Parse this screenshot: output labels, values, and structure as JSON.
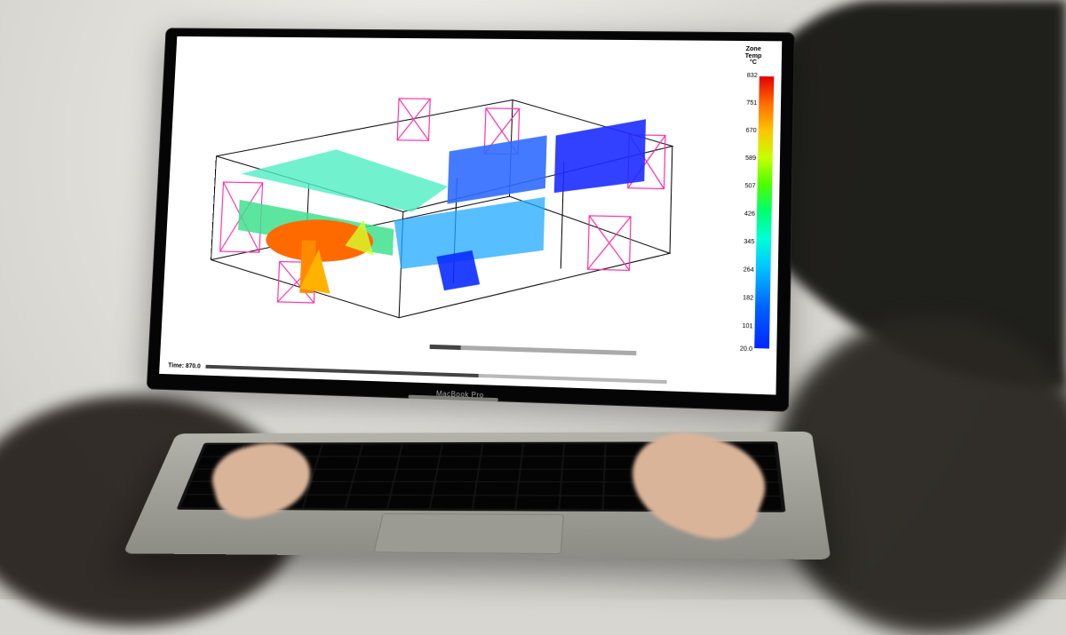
{
  "device_label": "MacBook Pro",
  "legend": {
    "title_line1": "Zone",
    "title_line2": "Temp",
    "title_line3": "°C",
    "ticks": [
      "832",
      "751",
      "670",
      "589",
      "507",
      "426",
      "345",
      "264",
      "182",
      "101",
      "20.0"
    ]
  },
  "playback": {
    "label": "Time: 870.0",
    "progress_percent": 60
  },
  "secondary_slider": {
    "progress_percent": 15
  },
  "chart_data": {
    "type": "heatmap",
    "variable": "Zone Temp",
    "unit": "°C",
    "colorbar": {
      "min": 20.0,
      "max": 832,
      "ticks": [
        832,
        751,
        670,
        589,
        507,
        426,
        345,
        264,
        182,
        101,
        20.0
      ]
    },
    "time": 870.0,
    "geometry": "3D multi-room building floorplan (wireframe)",
    "notable_features": {
      "hot_plume_approx_C": 800,
      "ambient_rooms_approx_C": 80,
      "mixing_zone_approx_C": 350
    }
  }
}
